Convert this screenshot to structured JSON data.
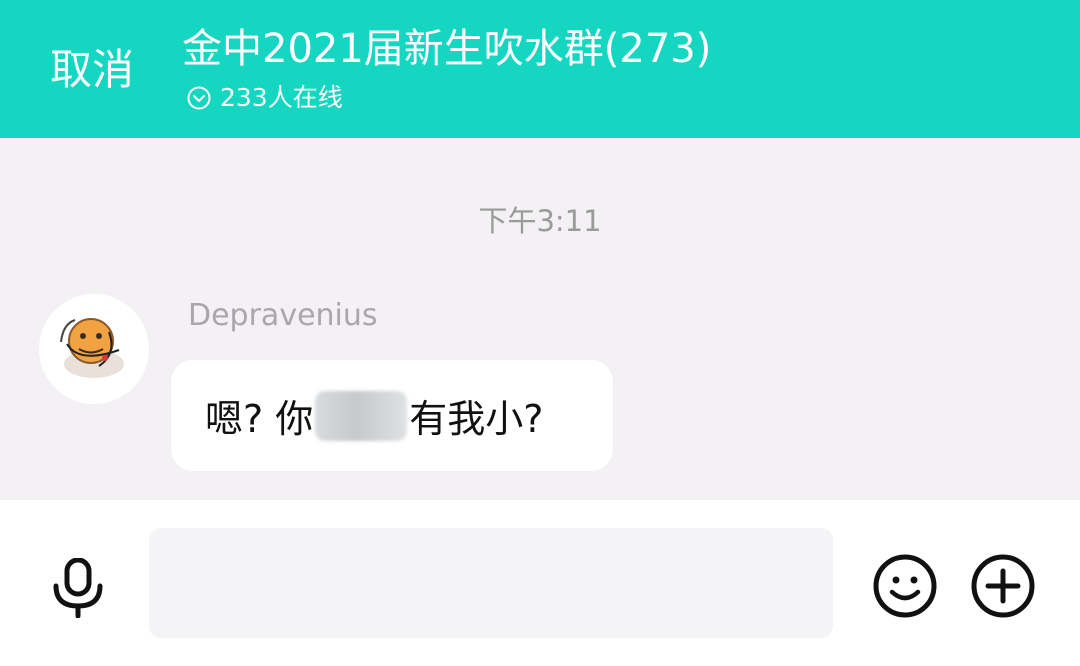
{
  "header": {
    "cancel_label": "取消",
    "title": "金中2021届新生吹水群(273)",
    "online_count": "233人在线",
    "bg_color": "#14d6c1"
  },
  "chat": {
    "timestamp": "下午3:11",
    "messages": [
      {
        "sender": "Depravenius",
        "text_before": "嗯? 你",
        "text_after": "有我小?",
        "avatar_icon": "cartoon-face-avatar"
      }
    ]
  },
  "input_bar": {
    "placeholder": "",
    "icons": [
      "microphone-icon",
      "emoji-icon",
      "plus-icon"
    ]
  }
}
